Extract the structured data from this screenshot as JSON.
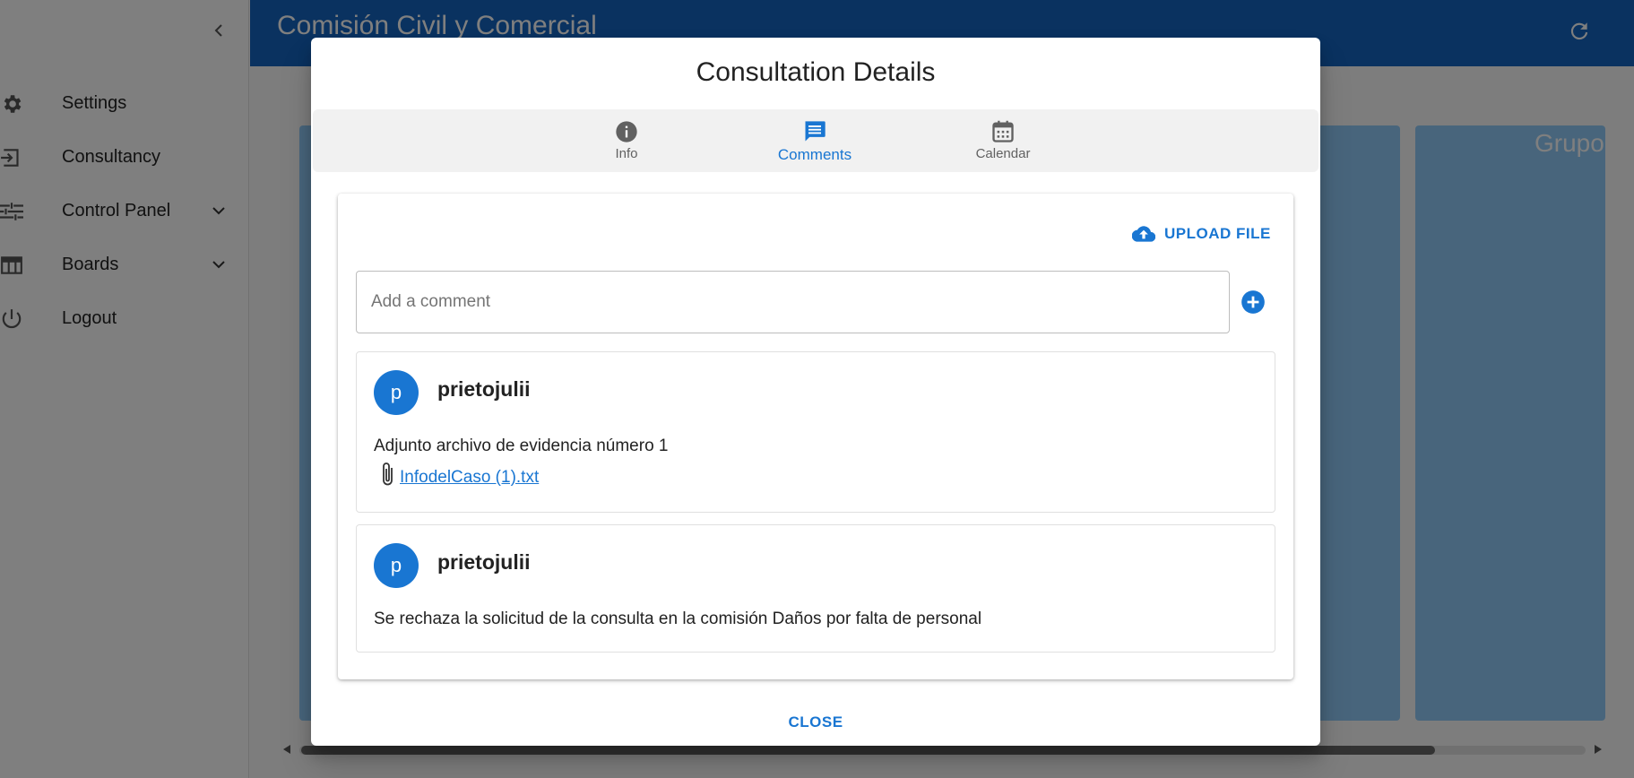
{
  "sidebar": {
    "items": [
      {
        "label": "Settings",
        "icon": "gear-icon"
      },
      {
        "label": "Consultancy",
        "icon": "login-icon"
      },
      {
        "label": "Control Panel",
        "icon": "tune-icon",
        "expandable": true
      },
      {
        "label": "Boards",
        "icon": "table-icon",
        "expandable": true
      },
      {
        "label": "Logout",
        "icon": "power-icon"
      }
    ]
  },
  "header": {
    "title": "Comisión Civil y Comercial"
  },
  "board": {
    "column_title_partial": "Grupo"
  },
  "dialog": {
    "title": "Consultation Details",
    "tabs": [
      {
        "label": "Info",
        "icon": "info-icon",
        "active": false
      },
      {
        "label": "Comments",
        "icon": "comment-icon",
        "active": true
      },
      {
        "label": "Calendar",
        "icon": "calendar-icon",
        "active": false
      }
    ],
    "upload_label": "UPLOAD FILE",
    "comment_placeholder": "Add a comment",
    "comment_value": "",
    "comments": [
      {
        "avatar_letter": "p",
        "author": "prietojulii",
        "text": "Adjunto archivo de evidencia número 1",
        "attachment": "InfodelCaso (1).txt"
      },
      {
        "avatar_letter": "p",
        "author": "prietojulii",
        "text": "Se rechaza la solicitud de la consulta en la comisión Daños por falta de personal"
      }
    ],
    "close_label": "CLOSE"
  },
  "colors": {
    "primary": "#1976d2",
    "header": "#1565c0",
    "board_column": "#90caf9"
  }
}
